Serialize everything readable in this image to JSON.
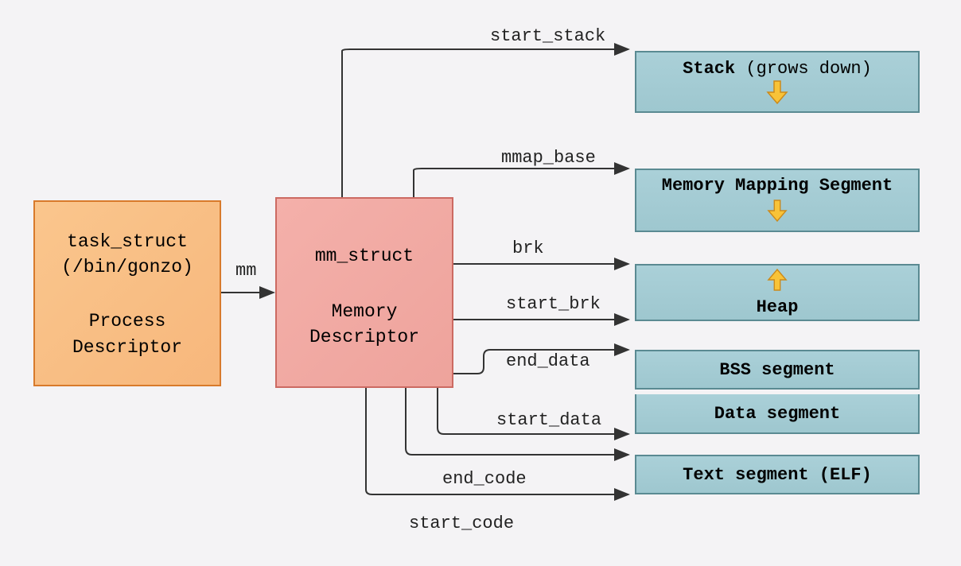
{
  "process": {
    "line1": "task_struct",
    "line2": "(/bin/gonzo)",
    "desc1": "Process",
    "desc2": "Descriptor"
  },
  "mm_link_label": "mm",
  "mm_struct": {
    "line1": "mm_struct",
    "desc1": "Memory",
    "desc2": "Descriptor"
  },
  "segments": {
    "stack_bold": "Stack",
    "stack_rest": " (grows down)",
    "mmap": "Memory Mapping Segment",
    "heap": "Heap",
    "bss": "BSS segment",
    "data": "Data segment",
    "text": "Text segment (ELF)"
  },
  "edges": {
    "start_stack": "start_stack",
    "mmap_base": "mmap_base",
    "brk": "brk",
    "start_brk": "start_brk",
    "end_data": "end_data",
    "start_data": "start_data",
    "end_code": "end_code",
    "start_code": "start_code"
  }
}
